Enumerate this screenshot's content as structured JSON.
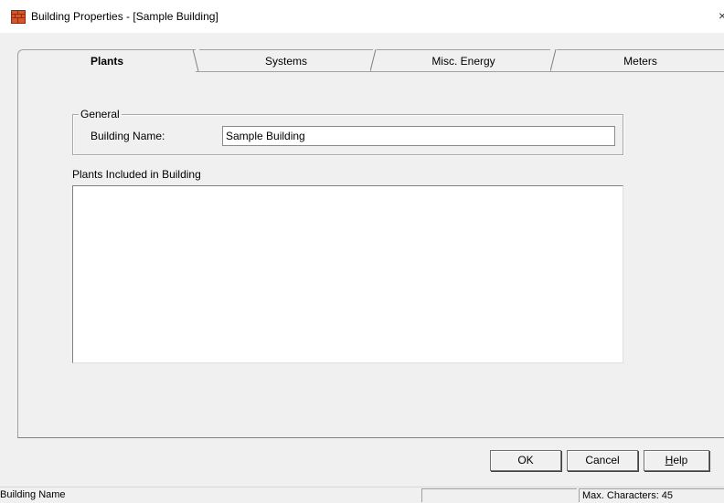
{
  "window": {
    "title": "Building Properties - [Sample Building]",
    "app_icon": "building-icon",
    "close_glyph": "×"
  },
  "tabs": [
    {
      "label": "Plants",
      "active": true
    },
    {
      "label": "Systems",
      "active": false
    },
    {
      "label": "Misc. Energy",
      "active": false
    },
    {
      "label": "Meters",
      "active": false
    }
  ],
  "general": {
    "group_title": "General",
    "building_name_label": "Building Name:",
    "building_name_value": "Sample Building"
  },
  "plants_list": {
    "label": "Plants Included in Building",
    "items": []
  },
  "buttons": {
    "ok": "OK",
    "cancel": "Cancel",
    "help_accel": "H",
    "help_rest": "elp"
  },
  "statusbar": {
    "hint": "Building Name",
    "middle": "",
    "max_chars": "Max. Characters: 45"
  },
  "colors": {
    "dialog_bg": "#f0f0f0",
    "titlebar_bg": "#ffffff",
    "icon_brick": "#b5401e"
  }
}
